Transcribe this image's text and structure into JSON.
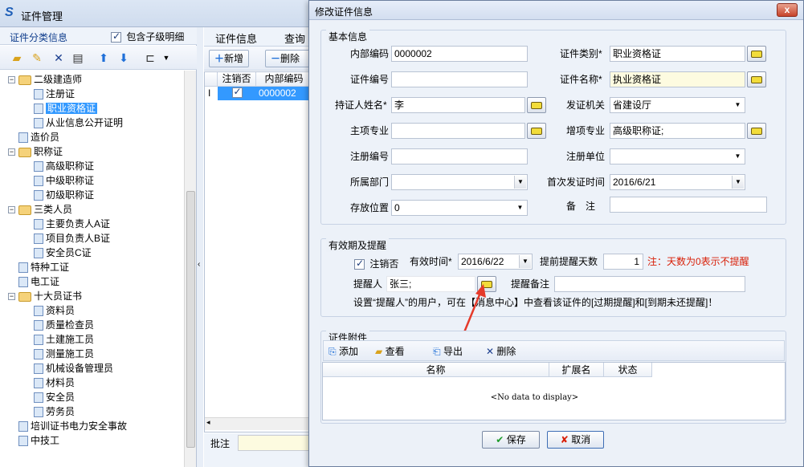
{
  "main_window": {
    "title": "证件管理",
    "left_panel": {
      "header": "证件分类信息",
      "include_children_label": "包含子级明细",
      "include_children_checked": true,
      "tree": [
        {
          "label": "二级建造师",
          "type": "folder",
          "level": 0,
          "expanded": true
        },
        {
          "label": "注册证",
          "type": "doc",
          "level": 1
        },
        {
          "label": "职业资格证",
          "type": "doc",
          "level": 1,
          "selected": true
        },
        {
          "label": "从业信息公开证明",
          "type": "doc",
          "level": 1
        },
        {
          "label": "造价员",
          "type": "doc",
          "level": 0
        },
        {
          "label": "职称证",
          "type": "folder",
          "level": 0,
          "expanded": true
        },
        {
          "label": "高级职称证",
          "type": "doc",
          "level": 1
        },
        {
          "label": "中级职称证",
          "type": "doc",
          "level": 1
        },
        {
          "label": "初级职称证",
          "type": "doc",
          "level": 1
        },
        {
          "label": "三类人员",
          "type": "folder",
          "level": 0,
          "expanded": true
        },
        {
          "label": "主要负责人A证",
          "type": "doc",
          "level": 1
        },
        {
          "label": "项目负责人B证",
          "type": "doc",
          "level": 1
        },
        {
          "label": "安全员C证",
          "type": "doc",
          "level": 1
        },
        {
          "label": "特种工证",
          "type": "doc",
          "level": 0
        },
        {
          "label": "电工证",
          "type": "doc",
          "level": 0
        },
        {
          "label": "十大员证书",
          "type": "folder",
          "level": 0,
          "expanded": true
        },
        {
          "label": "资料员",
          "type": "doc",
          "level": 1
        },
        {
          "label": "质量检查员",
          "type": "doc",
          "level": 1
        },
        {
          "label": "土建施工员",
          "type": "doc",
          "level": 1
        },
        {
          "label": "测量施工员",
          "type": "doc",
          "level": 1
        },
        {
          "label": "机械设备管理员",
          "type": "doc",
          "level": 1
        },
        {
          "label": "材料员",
          "type": "doc",
          "level": 1
        },
        {
          "label": "安全员",
          "type": "doc",
          "level": 1
        },
        {
          "label": "劳务员",
          "type": "doc",
          "level": 1
        },
        {
          "label": "培训证书电力安全事故",
          "type": "doc",
          "level": 0
        },
        {
          "label": "中技工",
          "type": "doc",
          "level": 0
        }
      ]
    },
    "middle_panel": {
      "tabs": [
        "证件信息",
        "查询关"
      ],
      "add_label": "新增",
      "delete_label": "删除",
      "columns": [
        "注销否",
        "内部编码"
      ],
      "rows": [
        {
          "cancelled": true,
          "code": "0000002"
        }
      ],
      "memo_label": "批注"
    }
  },
  "dialog": {
    "title": "修改证件信息",
    "close_label": "x",
    "basic": {
      "group_title": "基本信息",
      "internal_code_label": "内部编码",
      "internal_code": "0000002",
      "cert_type_label": "证件类别*",
      "cert_type": "职业资格证",
      "cert_no_label": "证件编号",
      "cert_no": "",
      "cert_name_label": "证件名称*",
      "cert_name": "执业资格证",
      "holder_label": "持证人姓名*",
      "holder": "李",
      "issuer_label": "发证机关",
      "issuer": "省建设厅",
      "major_label": "主项专业",
      "major": "",
      "extra_major_label": "增项专业",
      "extra_major": "高级职称证;",
      "reg_no_label": "注册编号",
      "reg_no": "",
      "reg_unit_label": "注册单位",
      "reg_unit": "",
      "dept_label": "所属部门",
      "dept": "",
      "first_issue_label": "首次发证时间",
      "first_issue": "2016/6/21",
      "location_label": "存放位置",
      "location": "0",
      "remark_label": "备　注",
      "remark": ""
    },
    "validity": {
      "group_title": "有效期及提醒",
      "cancelled_label": "注销否",
      "cancelled": true,
      "valid_until_label": "有效时间*",
      "valid_until": "2016/6/22",
      "remind_days_label": "提前提醒天数",
      "remind_days": "1",
      "remind_note": "注：天数为0表示不提醒",
      "reminder_label": "提醒人",
      "reminder": "张三;",
      "reminder_note_label": "提醒备注",
      "reminder_note": "",
      "hint": "设置“提醒人”的用户，可在【消息中心】中查看该证件的[过期提醒]和[到期未还提醒]！"
    },
    "attachments": {
      "group_title": "证件附件",
      "toolbar": [
        "添加",
        "查看",
        "导出",
        "删除"
      ],
      "columns": [
        "名称",
        "扩展名",
        "状态"
      ],
      "empty_text": "<No data to display>"
    },
    "save_label": "保存",
    "cancel_label": "取消"
  }
}
